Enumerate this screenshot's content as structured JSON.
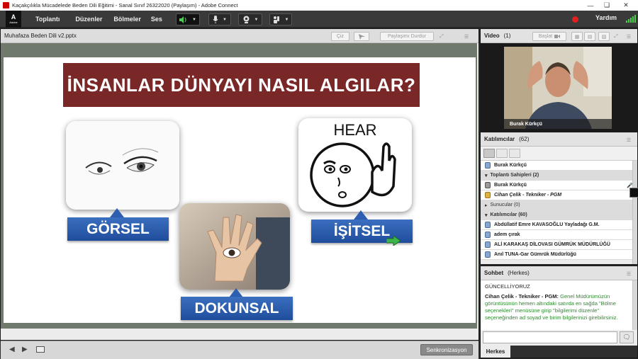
{
  "window": {
    "title": "Kaçakçılıkla Mücadelede Beden Dili Eğitimi - Sanal Sınıf  26322020 (Paylaşım) - Adobe Connect"
  },
  "logo": {
    "letter": "A",
    "subtitle": "Adobe"
  },
  "menu": {
    "items": [
      "Toplantı",
      "Düzenler",
      "Bölmeler",
      "Ses"
    ]
  },
  "toolbar": {
    "help": "Yardım",
    "speaker_icon": "speaker-icon",
    "mic_icon": "microphone-icon",
    "webcam_icon": "webcam-icon",
    "raise_hand_icon": "raise-hand-icon"
  },
  "share": {
    "filename": "Muhafaza Beden Dili v2.pptx",
    "draw_label": "Çiz",
    "stop_label": "Paylaşımı Durdur",
    "sync_label": "Senkronizasyon"
  },
  "slide": {
    "title": "İNSANLAR DÜNYAYI NASIL ALGILAR?",
    "labels": {
      "visual": "GÖRSEL",
      "auditory": "İŞİTSEL",
      "kinesthetic": "DOKUNSAL"
    },
    "hear": "HEAR"
  },
  "video": {
    "title": "Video",
    "count": "(1)",
    "start_label": "Başlat",
    "presenter": "Burak Kürkçü"
  },
  "participants": {
    "title": "Katılımcılar",
    "count": "(62)",
    "me": "Burak Kürkçü",
    "hosts_header": "Toplantı Sahipleri (2)",
    "hosts": [
      "Burak Kürkçü",
      "Cihan Çelik - Tekniker - PGM"
    ],
    "presenters_header": "Sunucular (0)",
    "attendees_header": "Katılımcılar (60)",
    "attendees": [
      "Abdüllatif Emre KAVASOĞLU Yayladağı G.M.",
      "adem çırak",
      "ALİ KARAKAŞ DİLOVASI GÜMRÜK MÜDÜRLÜĞÜ",
      "Anıl TUNA-Gar Gümrük Müdürlüğü"
    ]
  },
  "chat": {
    "title": "Sohbet",
    "scope": "(Herkes)",
    "messages": [
      {
        "sender": "",
        "text": "GÜNCELLİYORUZ"
      },
      {
        "sender": "Cihan Çelik - Tekniker - PGM:",
        "text": " Genel Müdürümüzün görüntüsünün hemen altındaki satırda en sağda \"Bölme seçenekleri\" menüsüne girip \"bilgilerimi düzenle\" seçeneğinden ad soyad ve birim bilgilerinizi girebilirsiniz."
      }
    ],
    "tab": "Herkes"
  },
  "colors": {
    "title_bg": "#7a2727",
    "label_blue": "#2f5fb0",
    "chat_green": "#2d8b2d",
    "record": "#e02020"
  }
}
